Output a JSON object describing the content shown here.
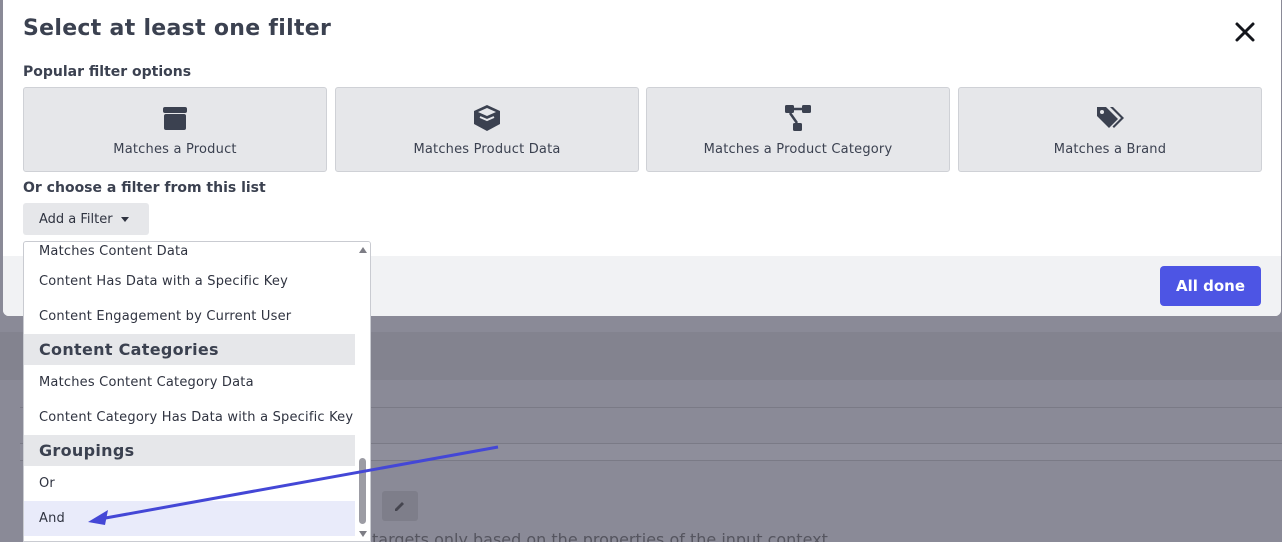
{
  "modal": {
    "title": "Select at least one filter",
    "popular_label": "Popular filter options",
    "cards": [
      {
        "label": "Matches a Product",
        "icon": "box-icon"
      },
      {
        "label": "Matches Product Data",
        "icon": "open-box-icon"
      },
      {
        "label": "Matches a Product Category",
        "icon": "hierarchy-icon"
      },
      {
        "label": "Matches a Brand",
        "icon": "tags-icon"
      }
    ],
    "choose_label": "Or choose a filter from this list",
    "add_filter_label": "Add a Filter",
    "all_done_label": "All done"
  },
  "dropdown": {
    "items_top": [
      "Matches Content Data",
      "Content Has Data with a Specific Key",
      "Content Engagement by Current User"
    ],
    "group_content_categories": "Content Categories",
    "items_categories": [
      "Matches Content Category Data",
      "Content Category Has Data with a Specific Key"
    ],
    "group_groupings": "Groupings",
    "items_groupings": [
      "Or",
      "And"
    ],
    "highlighted_item": "And"
  },
  "background": {
    "partial_text": "targets only based on the properties of the input context"
  },
  "colors": {
    "primary_button": "#4d55e4",
    "annotation_arrow": "#4447d6",
    "card_bg": "#e6e7ea",
    "backdrop": "#8a8a97"
  }
}
